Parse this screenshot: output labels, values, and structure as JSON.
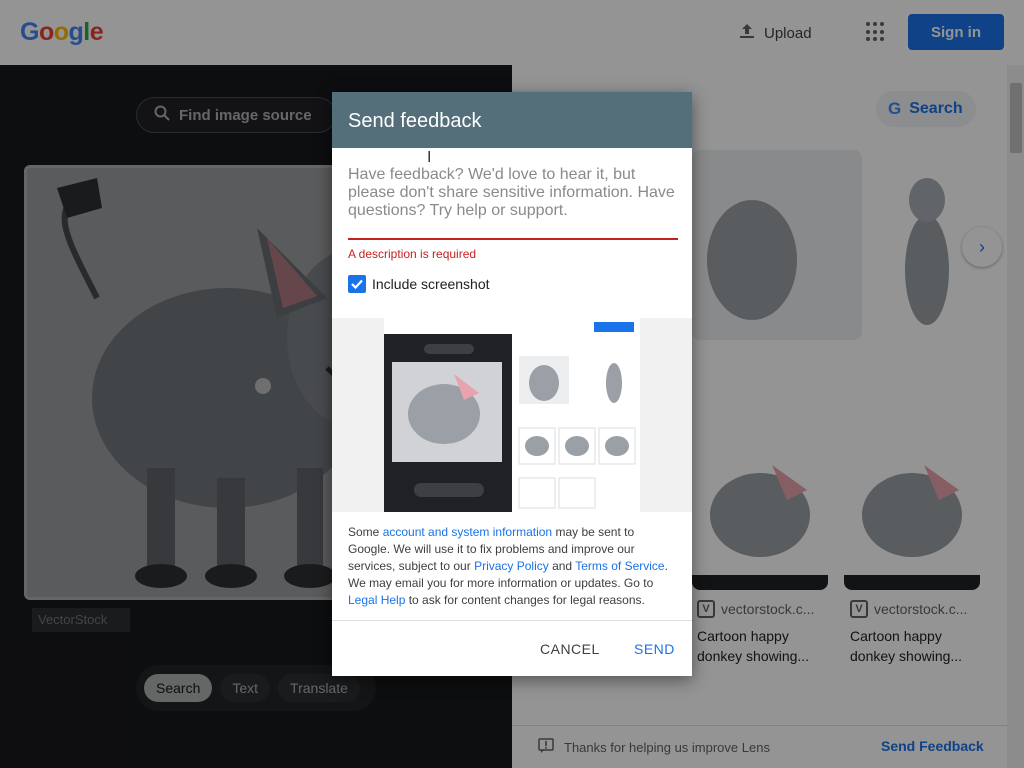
{
  "header": {
    "logo": [
      "G",
      "o",
      "o",
      "g",
      "l",
      "e"
    ],
    "logo_colors": [
      "#4285f4",
      "#ea4335",
      "#fbbc05",
      "#4285f4",
      "#34a853",
      "#ea4335"
    ],
    "upload_label": "Upload",
    "signin_label": "Sign in"
  },
  "left_pane": {
    "find_source_label": "Find image source",
    "watermark": "VectorStock",
    "chips": [
      "Search",
      "Text",
      "Translate"
    ],
    "active_chip": "Search"
  },
  "right_pane": {
    "search_label": "Search",
    "visual_cards": [
      {
        "source": "vectorstock.c...",
        "title": "Cartoon happy donkey showing..."
      },
      {
        "source": "vectorstock.c...",
        "title": "Cartoon happy donkey showing..."
      }
    ],
    "footer_thanks": "Thanks for helping us improve Lens",
    "footer_send": "Send Feedback"
  },
  "dialog": {
    "title": "Send feedback",
    "placeholder": "Have feedback? We'd love to hear it, but please don't share sensitive information. Have questions? Try help or support.",
    "error": "A description is required",
    "include_screenshot_label": "Include screenshot",
    "include_screenshot_checked": true,
    "legal": {
      "t1": "Some ",
      "l1": "account and system information",
      "t2": " may be sent to Google. We will use it to fix problems and improve our services, subject to our ",
      "l2": "Privacy Policy",
      "t3": " and ",
      "l3": "Terms of Service",
      "t4": ". We may email you for more information or updates. Go to ",
      "l4": "Legal Help",
      "t5": " to ask for content changes for legal reasons."
    },
    "cancel_label": "CANCEL",
    "send_label": "SEND"
  },
  "colors": {
    "accent": "#1a73e8",
    "dialog_header": "#546e7a",
    "error": "#c5221f"
  }
}
